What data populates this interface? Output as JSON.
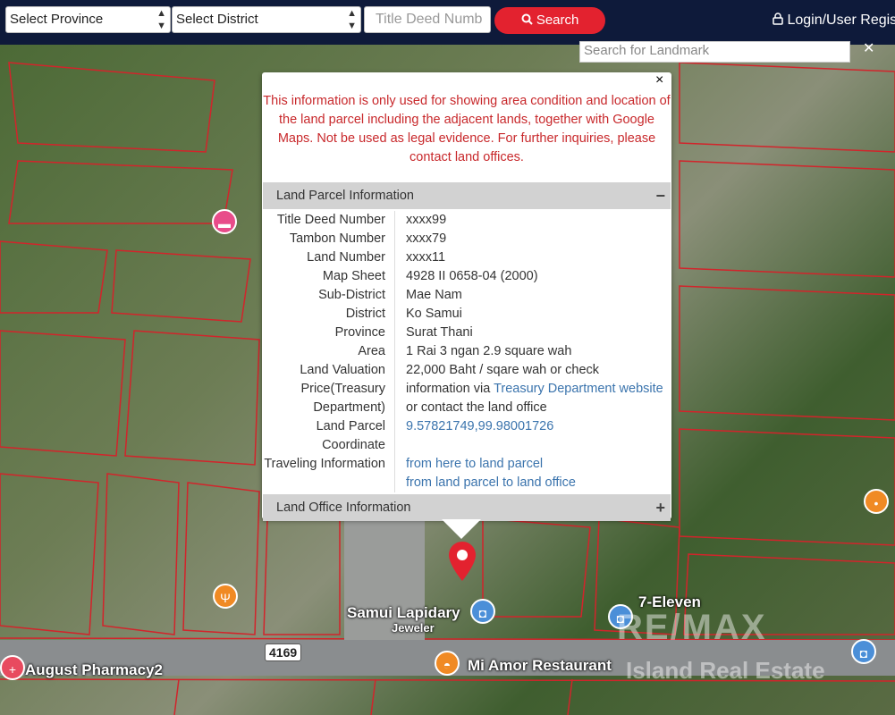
{
  "topbar": {
    "province_select": "Select Province",
    "district_select": "Select District",
    "title_deed_placeholder": "Title Deed Numb",
    "search_button": "Search",
    "login_label": "Login/User Regis"
  },
  "landmark_search": {
    "placeholder": "Search for Landmark"
  },
  "map_labels": {
    "jeweler": "Samui Lapidary",
    "jeweler_sub": "Jeweler",
    "restaurant": "Mi Amor Restaurant",
    "pharmacy": "August Pharmacy2",
    "seven_eleven": "7-Eleven",
    "route": "4169",
    "watermark_line1": "RE/MAX",
    "watermark_line2": "Island Real Estate"
  },
  "popup": {
    "warning": "This information is only used for showing area condition and location of the land parcel including the adjacent lands, together with Google Maps. Not be used as legal evidence. For further inquiries, please contact land offices.",
    "parcel_section_title": "Land Parcel Information",
    "parcel_toggle": "−",
    "office_section_title": "Land Office Information",
    "office_toggle": "+",
    "rows": {
      "title_deed_label": "Title Deed Number",
      "title_deed_value": "xxxx99",
      "tambon_label": "Tambon Number",
      "tambon_value": "xxxx79",
      "land_number_label": "Land Number",
      "land_number_value": "xxxx11",
      "map_sheet_label": "Map Sheet",
      "map_sheet_value": "4928 II 0658-04 (2000)",
      "sub_district_label": "Sub-District",
      "sub_district_value": "Mae Nam",
      "district_label": "District",
      "district_value": "Ko Samui",
      "province_label": "Province",
      "province_value": "Surat Thani",
      "area_label": "Area",
      "area_value": "1 Rai 3 ngan 2.9 square wah",
      "valuation_label1": "Land Valuation",
      "valuation_value1": "22,000 Baht / sqare wah or check",
      "valuation_label2": "Price(Treasury",
      "valuation_value2_prefix": "information via ",
      "valuation_value2_link": "Treasury Department website",
      "valuation_label3": "Department)",
      "valuation_value3": "or contact the land office",
      "coordinate_label1": "Land Parcel",
      "coordinate_value": "9.57821749,99.98001726",
      "coordinate_label2": "Coordinate",
      "travel_label": "Traveling Information",
      "travel_link1": "from here to land parcel",
      "travel_link2": "from land parcel to land office"
    }
  },
  "colors": {
    "topbar": "#0e1a3a",
    "search_button": "#e3222f",
    "warning_text": "#c8282b",
    "link": "#3b74ad"
  }
}
